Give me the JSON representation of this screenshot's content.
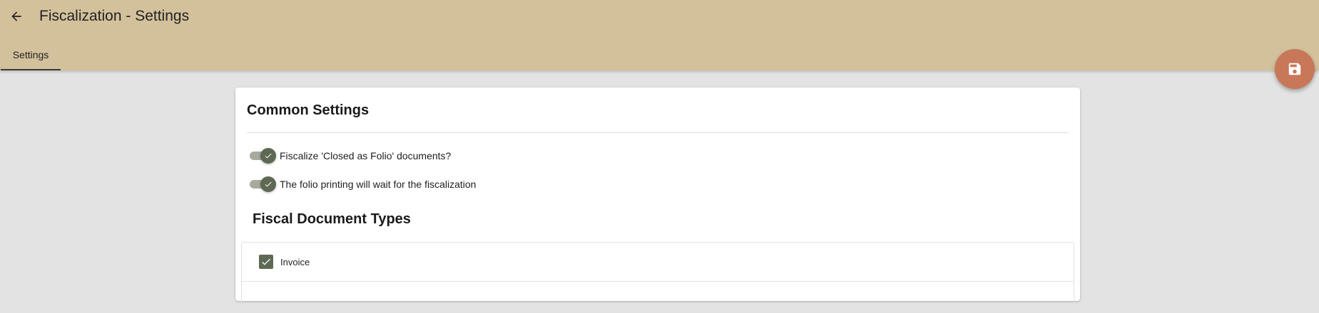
{
  "header": {
    "title": "Fiscalization - Settings",
    "back_icon": "arrow-left-icon",
    "background_color": "#d3c19c"
  },
  "tabs": [
    {
      "label": "Settings",
      "active": true
    }
  ],
  "fab": {
    "icon": "save-icon",
    "color": "#c87758"
  },
  "common_settings": {
    "title": "Common Settings",
    "toggles": [
      {
        "label": "Fiscalize 'Closed as Folio' documents?",
        "checked": true
      },
      {
        "label": "The folio printing will wait for the fiscalization",
        "checked": true
      }
    ]
  },
  "fiscal_document_types": {
    "title": "Fiscal Document Types",
    "items": [
      {
        "label": "Invoice",
        "checked": true
      }
    ]
  },
  "colors": {
    "accent": "#5e6953",
    "page_background": "#e3e3e3"
  }
}
